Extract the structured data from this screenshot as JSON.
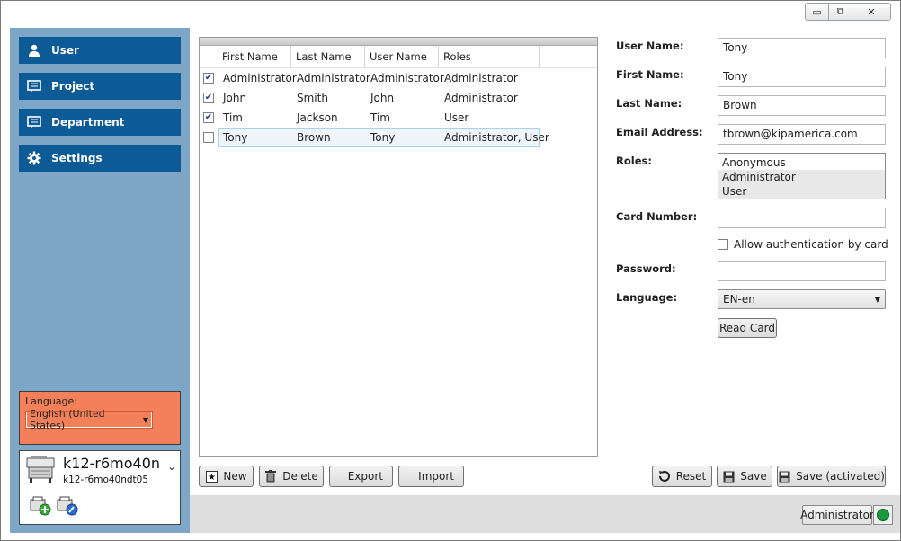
{
  "window": {
    "minimize_icon": "minimize-icon",
    "maximize_icon": "maximize-icon",
    "close_icon": "close-icon"
  },
  "sidebar": {
    "items": [
      {
        "label": "User",
        "icon": "user-icon"
      },
      {
        "label": "Project",
        "icon": "project-icon"
      },
      {
        "label": "Department",
        "icon": "department-icon"
      },
      {
        "label": "Settings",
        "icon": "gear-icon"
      }
    ],
    "nav_color": "#0d5b96",
    "background": "#7ea6c7",
    "language_label": "Language:",
    "language_value": "English (United States)",
    "language_box_color": "#f4805a",
    "device": {
      "name": "k12-r6mo40n",
      "subname": "k12-r6mo40ndt05"
    }
  },
  "table": {
    "headers": [
      "First Name",
      "Last Name",
      "User Name",
      "Roles"
    ],
    "rows": [
      {
        "checked": true,
        "first": "Administrator",
        "last": "Administrator",
        "user": "Administrator",
        "roles": "Administrator"
      },
      {
        "checked": true,
        "first": "John",
        "last": "Smith",
        "user": "John",
        "roles": "Administrator"
      },
      {
        "checked": true,
        "first": "Tim",
        "last": "Jackson",
        "user": "Tim",
        "roles": "User"
      },
      {
        "checked": false,
        "first": "Tony",
        "last": "Brown",
        "user": "Tony",
        "roles": "Administrator, User",
        "selected": true
      }
    ]
  },
  "table_actions": {
    "new": "New",
    "delete": "Delete",
    "export": "Export",
    "import": "Import"
  },
  "form": {
    "user_name_label": "User Name:",
    "user_name": "Tony",
    "first_name_label": "First Name:",
    "first_name": "Tony",
    "last_name_label": "Last Name:",
    "last_name": "Brown",
    "email_label": "Email Address:",
    "email": "tbrown@kipamerica.com",
    "roles_label": "Roles:",
    "roles": [
      "Anonymous",
      "Administrator",
      "User"
    ],
    "card_number_label": "Card Number:",
    "card_number": "",
    "auth_by_card_label": "Allow authentication by card",
    "password_label": "Password:",
    "password": "",
    "language_label": "Language:",
    "language_value": "EN-en",
    "read_card": "Read Card"
  },
  "form_actions": {
    "reset": "Reset",
    "save": "Save",
    "save_activated": "Save (activated)"
  },
  "status": {
    "user": "Administrator",
    "indicator_color": "#1a9b3b"
  }
}
